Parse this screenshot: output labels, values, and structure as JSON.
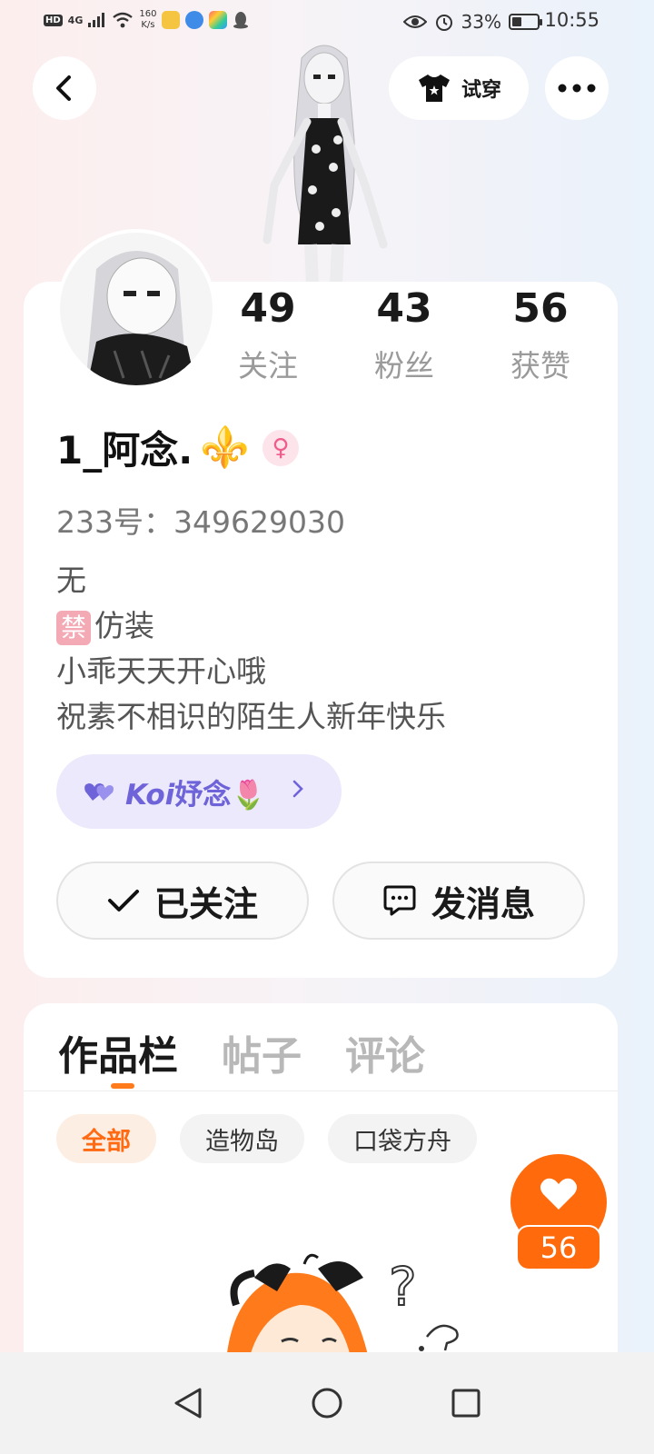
{
  "status_bar": {
    "hd": "HD",
    "network": "4G",
    "speed_value": "160",
    "speed_unit": "K/s",
    "battery": "33%",
    "time": "10:55"
  },
  "top_nav": {
    "tryon_label": "试穿"
  },
  "profile": {
    "stats": [
      {
        "value": "49",
        "label": "关注"
      },
      {
        "value": "43",
        "label": "粉丝"
      },
      {
        "value": "56",
        "label": "获赞"
      }
    ],
    "username": "1_阿念.",
    "fleur": "⚜️",
    "gender_icon": "♀",
    "uid": "233号：349629030",
    "bio": [
      "无",
      "仿装",
      "小乖天天开心哦",
      "祝素不相识的陌生人新年快乐"
    ],
    "ban_badge": "禁",
    "koi": {
      "prefix": "Koi",
      "text": "妤念",
      "emoji": "🌷"
    },
    "followed_label": "已关注",
    "message_label": "发消息"
  },
  "works": {
    "tabs": [
      "作品栏",
      "帖子",
      "评论"
    ],
    "chips": [
      "全部",
      "造物岛",
      "口袋方舟"
    ]
  },
  "like_fab": {
    "count": "56"
  },
  "colors": {
    "accent": "#ff6a0d",
    "koi": "#6f63d9",
    "gender": "#ef5d8a"
  }
}
